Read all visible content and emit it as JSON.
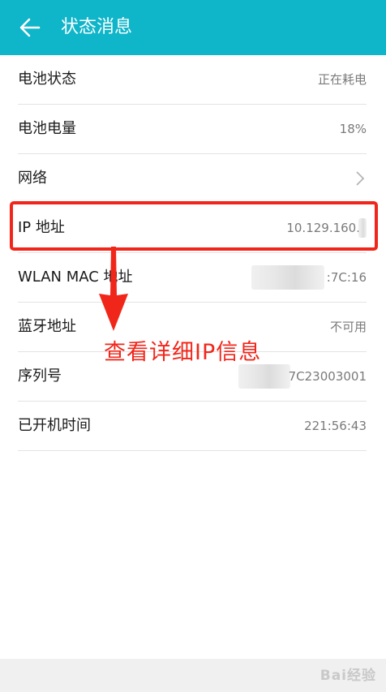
{
  "header": {
    "title": "状态消息"
  },
  "rows": [
    {
      "label": "电池状态",
      "value": "正在耗电"
    },
    {
      "label": "电池电量",
      "value": "18%"
    },
    {
      "label": "网络",
      "value": ""
    },
    {
      "label": "IP 地址",
      "value": "10.129.160."
    },
    {
      "label": "WLAN MAC 地址",
      "value": ":7C:16"
    },
    {
      "label": "蓝牙地址",
      "value": "不可用"
    },
    {
      "label": "序列号",
      "value": "7C23003001"
    },
    {
      "label": "已开机时间",
      "value": "221:56:43"
    }
  ],
  "annotation": {
    "text": "查看详细IP信息"
  },
  "watermark": {
    "text": "Bai经验"
  },
  "colors": {
    "header": "#0fb5c9",
    "highlight": "#f1261a"
  }
}
